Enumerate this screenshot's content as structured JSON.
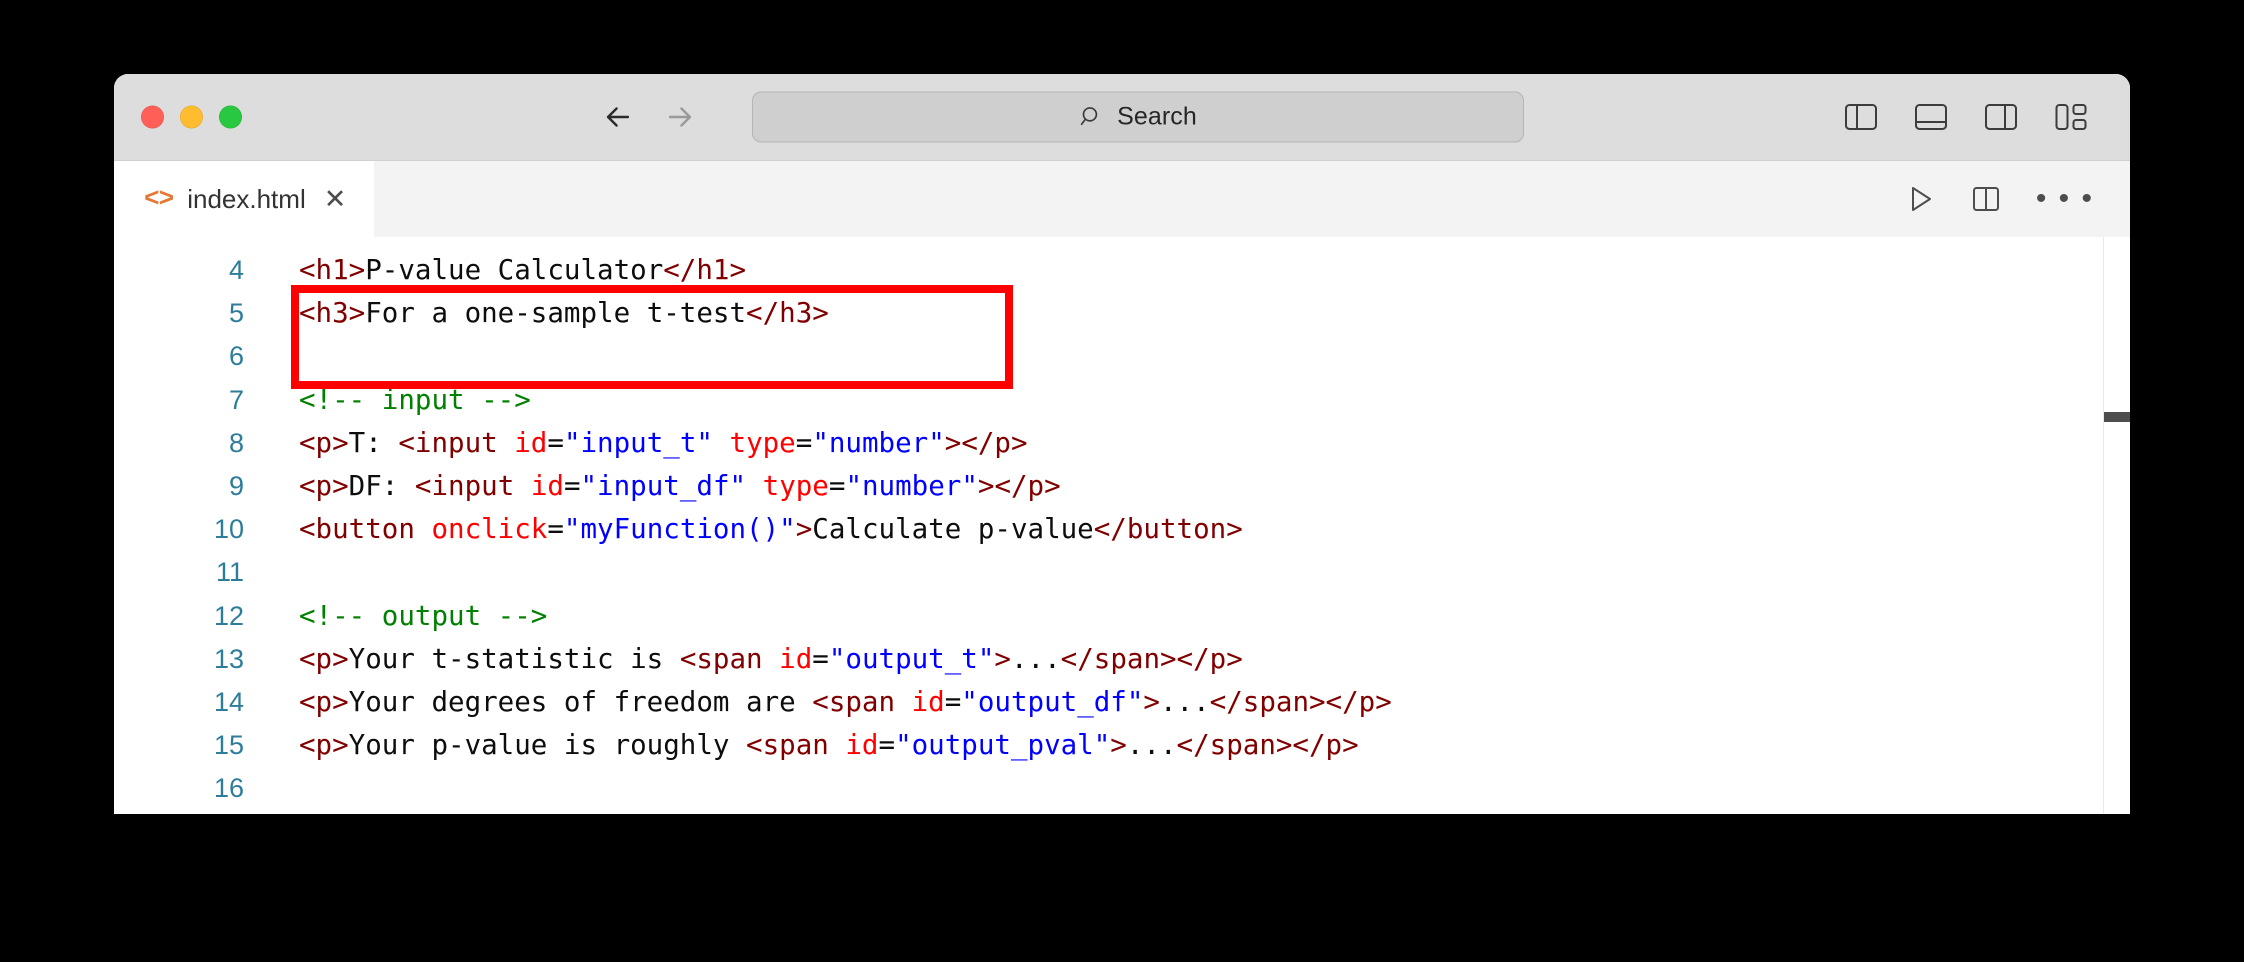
{
  "window": {
    "traffic_lights": [
      {
        "name": "close",
        "color": "#ff5f57"
      },
      {
        "name": "minimize",
        "color": "#febc2e"
      },
      {
        "name": "maximize",
        "color": "#28c840"
      }
    ]
  },
  "titlebar": {
    "back_icon": "arrow-left-icon",
    "forward_icon": "arrow-right-icon",
    "search": {
      "icon": "search-icon",
      "placeholder": "Search",
      "value": ""
    },
    "layout_buttons": [
      {
        "name": "toggle-primary-sidebar-icon"
      },
      {
        "name": "toggle-panel-icon"
      },
      {
        "name": "toggle-secondary-sidebar-icon"
      },
      {
        "name": "customize-layout-icon"
      }
    ]
  },
  "tabbar": {
    "tabs": [
      {
        "icon": "html-file-icon",
        "icon_glyph": "<>",
        "label": "index.html",
        "close_glyph": "✕",
        "active": true
      }
    ],
    "actions": [
      {
        "name": "run-button",
        "glyph": "play-icon"
      },
      {
        "name": "split-editor-button",
        "glyph": "split-editor-icon"
      },
      {
        "name": "more-actions-button",
        "glyph": "• • •"
      }
    ]
  },
  "editor": {
    "language": "html",
    "first_visible_line": 4,
    "lines": [
      {
        "number": "4",
        "tokens": [
          {
            "t": "tag",
            "s": "<h1>"
          },
          {
            "t": "plain",
            "s": "P-value Calculator"
          },
          {
            "t": "tag",
            "s": "</h1>"
          }
        ]
      },
      {
        "number": "5",
        "tokens": [
          {
            "t": "tag",
            "s": "<h3>"
          },
          {
            "t": "plain",
            "s": "For a one-sample t-test"
          },
          {
            "t": "tag",
            "s": "</h3>"
          }
        ]
      },
      {
        "number": "6",
        "tokens": []
      },
      {
        "number": "7",
        "tokens": [
          {
            "t": "comment",
            "s": "<!-- input -->"
          }
        ]
      },
      {
        "number": "8",
        "tokens": [
          {
            "t": "tag",
            "s": "<p>"
          },
          {
            "t": "plain",
            "s": "T: "
          },
          {
            "t": "tag",
            "s": "<input "
          },
          {
            "t": "attr",
            "s": "id"
          },
          {
            "t": "plain",
            "s": "="
          },
          {
            "t": "val",
            "s": "\"input_t\""
          },
          {
            "t": "plain",
            "s": " "
          },
          {
            "t": "attr",
            "s": "type"
          },
          {
            "t": "plain",
            "s": "="
          },
          {
            "t": "val",
            "s": "\"number\""
          },
          {
            "t": "tag",
            "s": "></p>"
          }
        ]
      },
      {
        "number": "9",
        "tokens": [
          {
            "t": "tag",
            "s": "<p>"
          },
          {
            "t": "plain",
            "s": "DF: "
          },
          {
            "t": "tag",
            "s": "<input "
          },
          {
            "t": "attr",
            "s": "id"
          },
          {
            "t": "plain",
            "s": "="
          },
          {
            "t": "val",
            "s": "\"input_df\""
          },
          {
            "t": "plain",
            "s": " "
          },
          {
            "t": "attr",
            "s": "type"
          },
          {
            "t": "plain",
            "s": "="
          },
          {
            "t": "val",
            "s": "\"number\""
          },
          {
            "t": "tag",
            "s": "></p>"
          }
        ]
      },
      {
        "number": "10",
        "tokens": [
          {
            "t": "tag",
            "s": "<button "
          },
          {
            "t": "attr",
            "s": "onclick"
          },
          {
            "t": "plain",
            "s": "="
          },
          {
            "t": "val",
            "s": "\"myFunction()\""
          },
          {
            "t": "tag",
            "s": ">"
          },
          {
            "t": "plain",
            "s": "Calculate p-value"
          },
          {
            "t": "tag",
            "s": "</button>"
          }
        ]
      },
      {
        "number": "11",
        "tokens": []
      },
      {
        "number": "12",
        "tokens": [
          {
            "t": "comment",
            "s": "<!-- output -->"
          }
        ]
      },
      {
        "number": "13",
        "tokens": [
          {
            "t": "tag",
            "s": "<p>"
          },
          {
            "t": "plain",
            "s": "Your t-statistic is "
          },
          {
            "t": "tag",
            "s": "<span "
          },
          {
            "t": "attr",
            "s": "id"
          },
          {
            "t": "plain",
            "s": "="
          },
          {
            "t": "val",
            "s": "\"output_t\""
          },
          {
            "t": "tag",
            "s": ">"
          },
          {
            "t": "plain",
            "s": "..."
          },
          {
            "t": "tag",
            "s": "</span></p>"
          }
        ]
      },
      {
        "number": "14",
        "tokens": [
          {
            "t": "tag",
            "s": "<p>"
          },
          {
            "t": "plain",
            "s": "Your degrees of freedom are "
          },
          {
            "t": "tag",
            "s": "<span "
          },
          {
            "t": "attr",
            "s": "id"
          },
          {
            "t": "plain",
            "s": "="
          },
          {
            "t": "val",
            "s": "\"output_df\""
          },
          {
            "t": "tag",
            "s": ">"
          },
          {
            "t": "plain",
            "s": "..."
          },
          {
            "t": "tag",
            "s": "</span></p>"
          }
        ]
      },
      {
        "number": "15",
        "tokens": [
          {
            "t": "tag",
            "s": "<p>"
          },
          {
            "t": "plain",
            "s": "Your p-value is roughly "
          },
          {
            "t": "tag",
            "s": "<span "
          },
          {
            "t": "attr",
            "s": "id"
          },
          {
            "t": "plain",
            "s": "="
          },
          {
            "t": "val",
            "s": "\"output_pval\""
          },
          {
            "t": "tag",
            "s": ">"
          },
          {
            "t": "plain",
            "s": "..."
          },
          {
            "t": "tag",
            "s": "</span></p>"
          }
        ]
      },
      {
        "number": "16",
        "tokens": []
      }
    ],
    "annotation": {
      "name": "red-highlight-box",
      "color": "#ff0000",
      "covers_lines": [
        8,
        9,
        10
      ]
    },
    "colors": {
      "tag": "#800000",
      "attribute_name": "#ff0000",
      "attribute_value": "#0000ff",
      "text": "#0d0d0d",
      "comment": "#008000",
      "line_number": "#2d7d9a",
      "background": "#ffffff"
    }
  }
}
